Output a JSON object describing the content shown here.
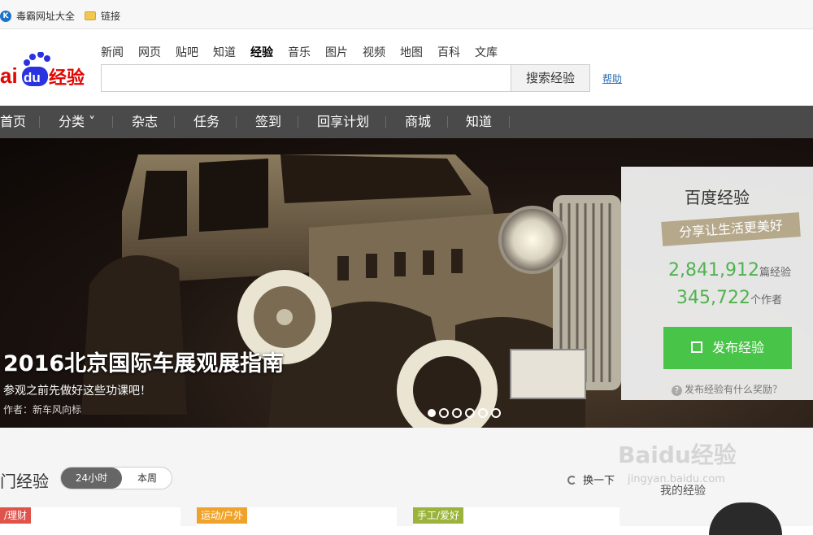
{
  "bookmarks": [
    {
      "label": "毒霸网址大全",
      "icon": "globe-icon"
    },
    {
      "label": "链接",
      "icon": "folder-icon"
    }
  ],
  "header": {
    "logo_text": "Bai du 经验",
    "nav": [
      "新闻",
      "网页",
      "贴吧",
      "知道",
      "经验",
      "音乐",
      "图片",
      "视频",
      "地图",
      "百科",
      "文库"
    ],
    "search_placeholder": "",
    "search_button": "搜索经验",
    "help": "帮助"
  },
  "mainnav": [
    "首页",
    "分类 ˅",
    "杂志",
    "任务",
    "签到",
    "回享计划",
    "商城",
    "知道"
  ],
  "banner": {
    "title": "2016北京国际车展观展指南",
    "subtitle": "参观之前先做好这些功课吧！",
    "author": "作者：新车风向标"
  },
  "side_panel": {
    "title": "百度经验",
    "slogan": "分享让生活更美好",
    "exp_count": "2,841,912",
    "exp_unit": "篇经验",
    "author_count": "345,722",
    "author_unit": "个作者",
    "publish_button": "发布经验",
    "faq": "发布经验有什么奖励？"
  },
  "section": {
    "title": "门经验",
    "toggle_24h": "24小时",
    "toggle_week": "本周",
    "refresh": "换一下",
    "tags": [
      "/理财",
      "运动/户外",
      "手工/爱好"
    ],
    "my_exp": "我的经验",
    "watermark": "Baidu经验",
    "watermark_sub": "jingyan.baidu.com"
  },
  "colors": {
    "brand_red": "#e10602",
    "brand_blue": "#2932e1",
    "publish_green": "#48c448",
    "count_green": "#4fb34f"
  }
}
